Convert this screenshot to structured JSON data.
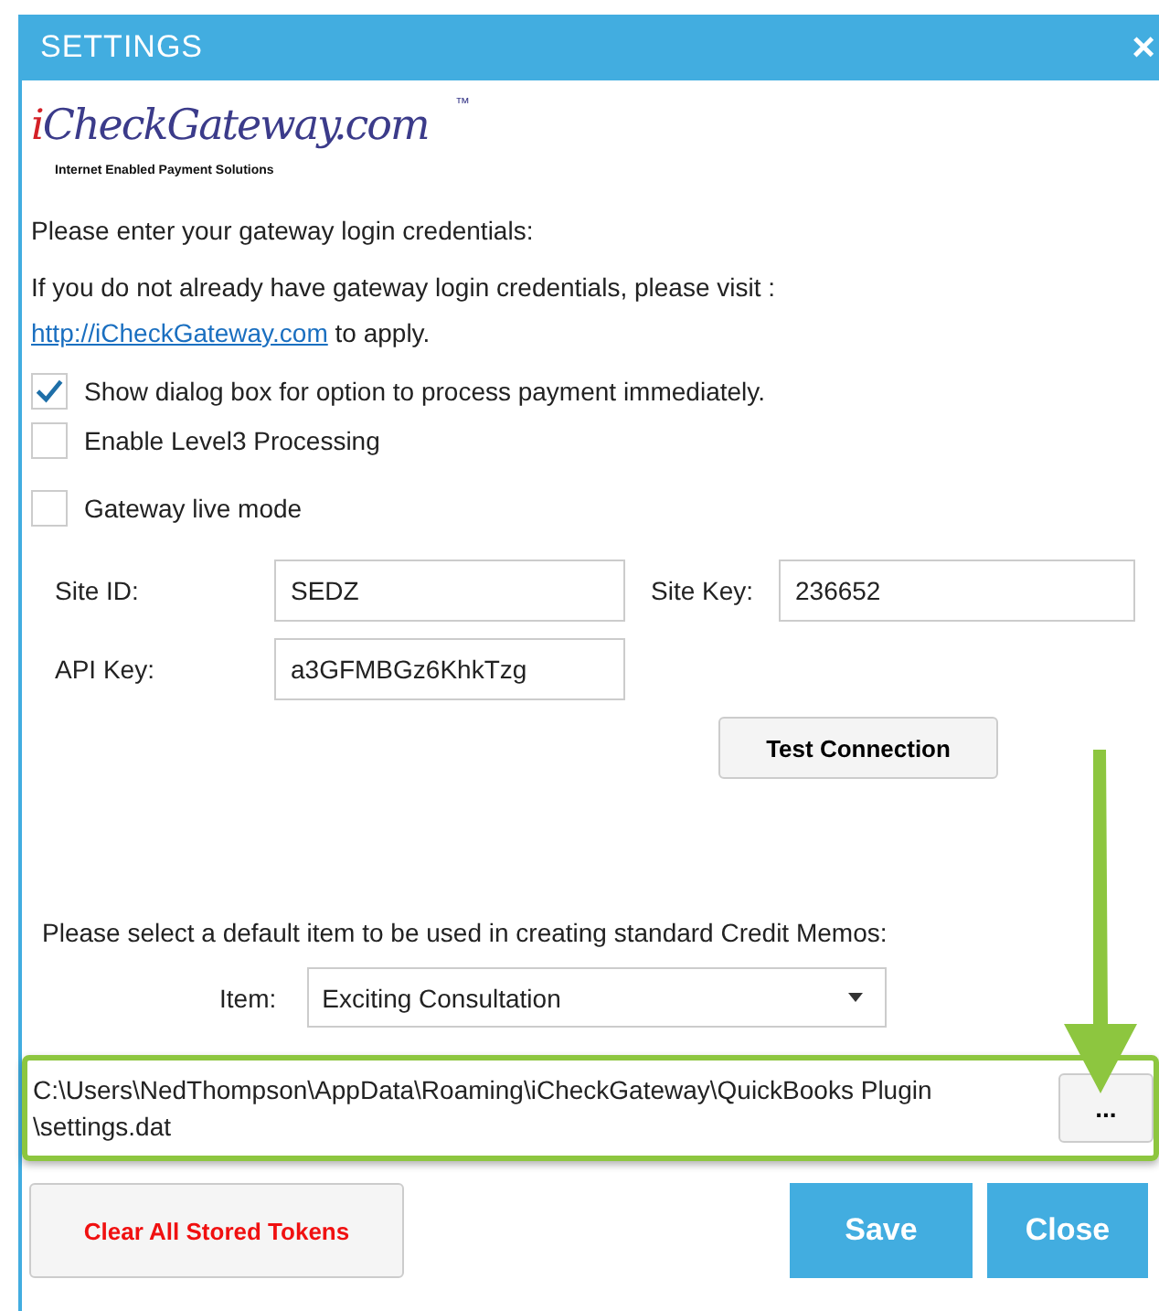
{
  "window": {
    "title": "SETTINGS",
    "close": "×"
  },
  "logo": {
    "name": "iCheckGateway.com",
    "trademark": "™",
    "tagline": "Internet Enabled Payment Solutions"
  },
  "intro": "Please enter your gateway login credentials:",
  "visit": {
    "text": "If you do not already have gateway login credentials, please visit :",
    "link": "http://iCheckGateway.com",
    "after": "to apply."
  },
  "options": [
    {
      "label": "Show dialog box for option to process payment immediately.",
      "checked": true
    },
    {
      "label": "Enable Level3 Processing",
      "checked": false
    },
    {
      "label": "Gateway live mode",
      "checked": false
    }
  ],
  "fields": [
    {
      "label": "Site ID:",
      "value": "SEDZ"
    },
    {
      "label": "Site Key:",
      "value": "236652"
    },
    {
      "label": "API Key:",
      "value": "a3GFMBGz6KhkTzg"
    }
  ],
  "test_button": "Test Connection",
  "credit_memo": {
    "prompt": "Please select a default item to be used in creating standard Credit Memos:",
    "label": "Item:",
    "value": "Exciting Consultation"
  },
  "file_path": {
    "value": "C:\\Users\\NedThompson\\AppData\\Roaming\\iCheckGateway\\QuickBooks Plugin \\settings.dat",
    "browse": "..."
  },
  "buttons": [
    {
      "label": "Clear All Stored Tokens",
      "kind": "danger"
    },
    {
      "label": "Save",
      "kind": "primary"
    },
    {
      "label": "Close",
      "kind": "primary"
    }
  ]
}
